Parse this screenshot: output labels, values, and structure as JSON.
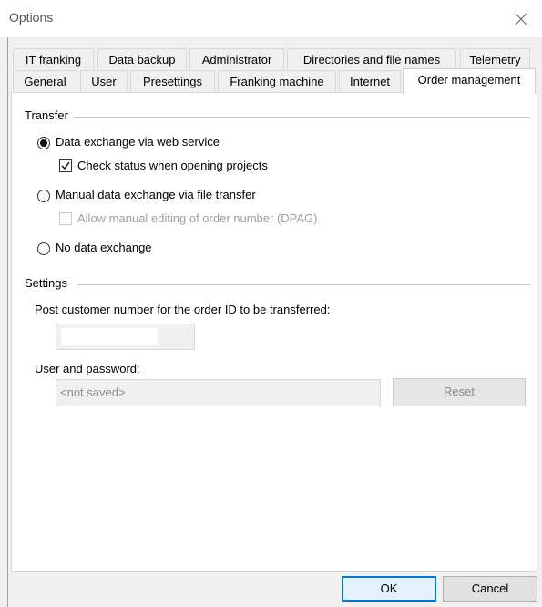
{
  "window": {
    "title": "Options"
  },
  "tabs_top": [
    {
      "label": "IT franking"
    },
    {
      "label": "Data backup"
    },
    {
      "label": "Administrator"
    },
    {
      "label": "Directories and file names"
    },
    {
      "label": "Telemetry"
    }
  ],
  "tabs_bottom": [
    {
      "label": "General"
    },
    {
      "label": "User"
    },
    {
      "label": "Presettings"
    },
    {
      "label": "Franking machine"
    },
    {
      "label": "Internet"
    },
    {
      "label": "Order management",
      "active": true
    }
  ],
  "transfer": {
    "group_label": "Transfer",
    "option_webservice": "Data exchange via web service",
    "check_status": "Check status when opening projects",
    "option_manual": "Manual data exchange via file transfer",
    "allow_manual_edit": "Allow manual editing of order number (DPAG)",
    "option_none": "No data exchange",
    "selected": "webservice",
    "check_status_checked": true,
    "allow_manual_edit_checked": false
  },
  "settings": {
    "group_label": "Settings",
    "post_customer_label": "Post customer number for the order ID to be transferred:",
    "post_customer_value": "",
    "user_password_label": "User and password:",
    "user_password_value": "<not saved>",
    "reset_label": "Reset"
  },
  "footer": {
    "ok_label": "OK",
    "cancel_label": "Cancel"
  }
}
